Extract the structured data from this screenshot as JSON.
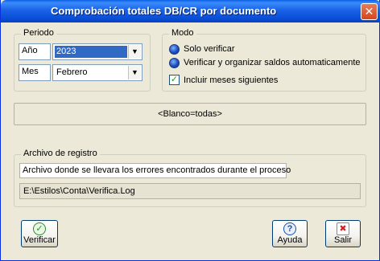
{
  "window": {
    "title": "Comprobación totales DB/CR por documento",
    "close_glyph": "✕"
  },
  "periodo": {
    "legend": "Periodo",
    "year_label": "Año",
    "year_value": "2023",
    "month_label": "Mes",
    "month_value": "Febrero"
  },
  "modo": {
    "legend": "Modo",
    "option1": "Solo verificar",
    "option2": "Verificar y organizar saldos automaticamente",
    "checkbox_label": "Incluir meses siguientes",
    "checkbox_checked": true
  },
  "blank_bar": {
    "text": "<Blanco=todas>"
  },
  "archivo": {
    "legend": "Archivo de registro",
    "description": "Archivo donde se llevara los errores encontrados durante el proceso",
    "path": "E:\\Estilos\\Conta\\Verifica.Log"
  },
  "buttons": {
    "verificar": "Verificar",
    "ayuda": "Ayuda",
    "salir": "Salir"
  },
  "icons": {
    "verificar": "check-circle-icon",
    "ayuda": "help-icon",
    "salir": "exit-door-icon"
  },
  "colors": {
    "title_bar": "#0b4fd9",
    "selection": "#316ac5",
    "window_face": "#ece9d8"
  }
}
